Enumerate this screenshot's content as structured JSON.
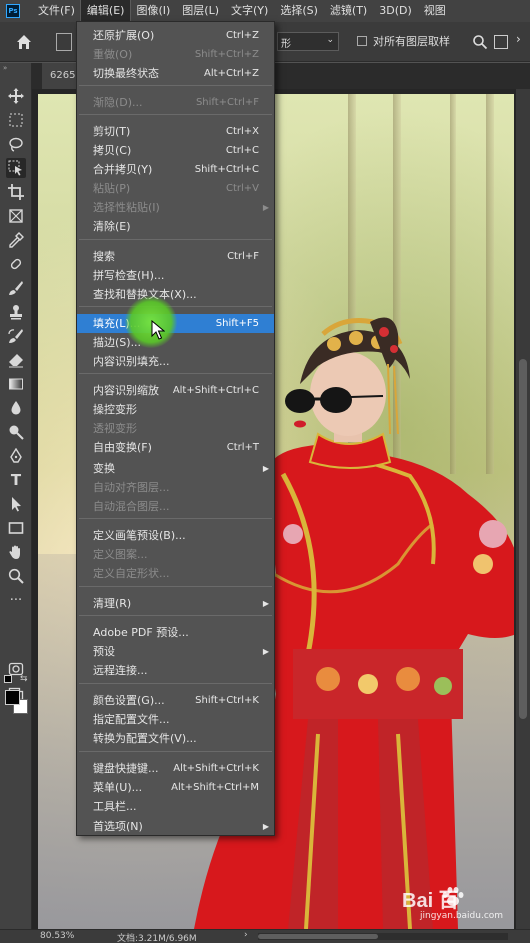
{
  "app": {
    "logo": "Ps"
  },
  "menubar": {
    "items": [
      "文件(F)",
      "编辑(E)",
      "图像(I)",
      "图层(L)",
      "文字(Y)",
      "选择(S)",
      "滤镜(T)",
      "3D(D)",
      "视图"
    ],
    "active_index": 1
  },
  "options": {
    "select_value": "形",
    "checkbox_label": "对所有图层取样",
    "checkbox_checked": false
  },
  "document": {
    "tab_label": "6265"
  },
  "edit_menu": {
    "items": [
      {
        "label": "还原扩展(O)",
        "shortcut": "Ctrl+Z",
        "disabled": false
      },
      {
        "label": "重做(O)",
        "shortcut": "Shift+Ctrl+Z",
        "disabled": true
      },
      {
        "label": "切换最终状态",
        "shortcut": "Alt+Ctrl+Z",
        "disabled": false
      },
      {
        "label": "渐隐(D)...",
        "shortcut": "Shift+Ctrl+F",
        "disabled": true
      },
      {
        "label": "剪切(T)",
        "shortcut": "Ctrl+X",
        "disabled": false
      },
      {
        "label": "拷贝(C)",
        "shortcut": "Ctrl+C",
        "disabled": false
      },
      {
        "label": "合并拷贝(Y)",
        "shortcut": "Shift+Ctrl+C",
        "disabled": false
      },
      {
        "label": "粘贴(P)",
        "shortcut": "Ctrl+V",
        "disabled": true
      },
      {
        "label": "选择性粘贴(I)",
        "shortcut": "",
        "disabled": true,
        "submenu": true
      },
      {
        "label": "清除(E)",
        "shortcut": "",
        "disabled": false
      },
      {
        "label": "搜索",
        "shortcut": "Ctrl+F",
        "disabled": false
      },
      {
        "label": "拼写检查(H)...",
        "shortcut": "",
        "disabled": false
      },
      {
        "label": "查找和替换文本(X)...",
        "shortcut": "",
        "disabled": false
      },
      {
        "label": "填充(L)...",
        "shortcut": "Shift+F5",
        "disabled": false,
        "highlighted": true
      },
      {
        "label": "描边(S)...",
        "shortcut": "",
        "disabled": false
      },
      {
        "label": "内容识别填充...",
        "shortcut": "",
        "disabled": false
      },
      {
        "label": "内容识别缩放",
        "shortcut": "Alt+Shift+Ctrl+C",
        "disabled": false
      },
      {
        "label": "操控变形",
        "shortcut": "",
        "disabled": false
      },
      {
        "label": "透视变形",
        "shortcut": "",
        "disabled": true
      },
      {
        "label": "自由变换(F)",
        "shortcut": "Ctrl+T",
        "disabled": false
      },
      {
        "label": "变换",
        "shortcut": "",
        "disabled": false,
        "submenu": true
      },
      {
        "label": "自动对齐图层...",
        "shortcut": "",
        "disabled": true
      },
      {
        "label": "自动混合图层...",
        "shortcut": "",
        "disabled": true
      },
      {
        "label": "定义画笔预设(B)...",
        "shortcut": "",
        "disabled": false
      },
      {
        "label": "定义图案...",
        "shortcut": "",
        "disabled": true
      },
      {
        "label": "定义自定形状...",
        "shortcut": "",
        "disabled": true
      },
      {
        "label": "清理(R)",
        "shortcut": "",
        "disabled": false,
        "submenu": true
      },
      {
        "label": "Adobe PDF 预设...",
        "shortcut": "",
        "disabled": false
      },
      {
        "label": "预设",
        "shortcut": "",
        "disabled": false,
        "submenu": true
      },
      {
        "label": "远程连接...",
        "shortcut": "",
        "disabled": false
      },
      {
        "label": "颜色设置(G)...",
        "shortcut": "Shift+Ctrl+K",
        "disabled": false
      },
      {
        "label": "指定配置文件...",
        "shortcut": "",
        "disabled": false
      },
      {
        "label": "转换为配置文件(V)...",
        "shortcut": "",
        "disabled": false
      },
      {
        "label": "键盘快捷键...",
        "shortcut": "Alt+Shift+Ctrl+K",
        "disabled": false
      },
      {
        "label": "菜单(U)...",
        "shortcut": "Alt+Shift+Ctrl+M",
        "disabled": false
      },
      {
        "label": "工具栏...",
        "shortcut": "",
        "disabled": false
      },
      {
        "label": "首选项(N)",
        "shortcut": "",
        "disabled": false,
        "submenu": true
      }
    ]
  },
  "toolbar": {
    "tools": [
      "move-icon",
      "marquee-icon",
      "lasso-icon",
      "object-select-icon",
      "crop-icon",
      "frame-tool-icon",
      "eyedropper-icon",
      "healing-brush-icon",
      "brush-icon",
      "clone-stamp-icon",
      "history-brush-icon",
      "eraser-icon",
      "gradient-icon",
      "blur-icon",
      "dodge-icon",
      "pen-icon",
      "type-icon",
      "path-select-icon",
      "rectangle-icon",
      "hand-icon",
      "zoom-icon",
      "more-tools-icon"
    ],
    "selected": "object-select-icon",
    "foreground_color": "#000000",
    "background_color": "#ffffff"
  },
  "status": {
    "zoom": "80.53%",
    "doc_info": "文档:3.21M/6.96M"
  },
  "watermark": {
    "brand": "Bai  百",
    "url": "jingyan.baidu.com"
  }
}
